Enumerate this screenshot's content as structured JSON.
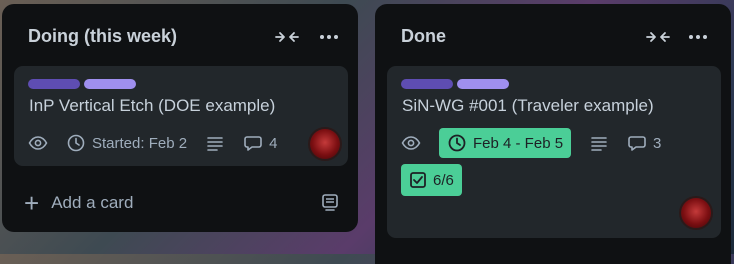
{
  "lists": [
    {
      "title": "Doing (this week)",
      "add_card_label": "Add a card",
      "cards": [
        {
          "title": "InP Vertical Etch (DOE example)",
          "labels": [
            "#5e4db2",
            "#9f8fef"
          ],
          "badges": {
            "watch_icon": "eye-icon",
            "date_text": "Started: Feb 2",
            "description_icon": "description-icon",
            "comments_count": "4"
          }
        }
      ]
    },
    {
      "title": "Done",
      "cards": [
        {
          "title": "SiN-WG #001 (Traveler example)",
          "labels": [
            "#5e4db2",
            "#9f8fef"
          ],
          "badges": {
            "watch_icon": "eye-icon",
            "date_text": "Feb 4 - Feb 5",
            "date_status_color": "#4bce97",
            "description_icon": "description-icon",
            "comments_count": "3",
            "checklist_text": "6/6"
          }
        }
      ]
    }
  ],
  "header_icons": [
    "collapse-icon",
    "more-icon"
  ]
}
